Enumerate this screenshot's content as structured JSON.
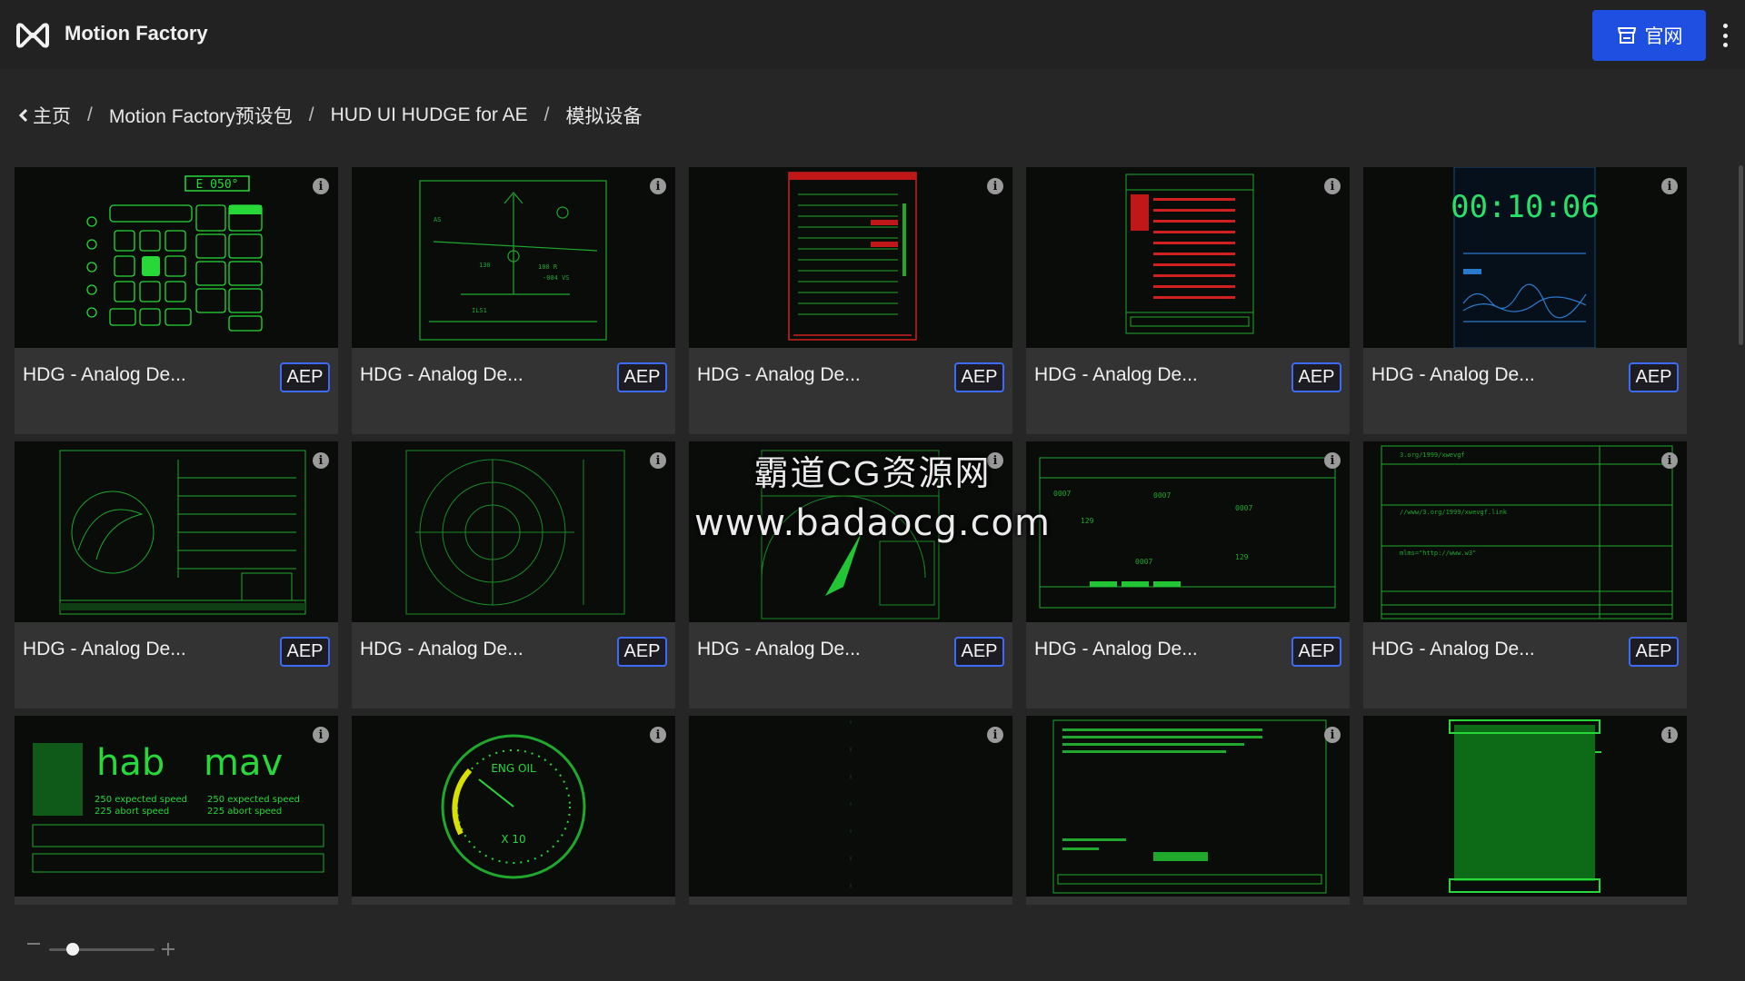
{
  "header": {
    "brand": "Motion Factory",
    "site_button_label": "官网"
  },
  "breadcrumb": {
    "items": [
      "主页",
      "Motion Factory预设包",
      "HUD UI HUDGE for AE",
      "模拟设备"
    ],
    "separator": "/"
  },
  "cards": [
    {
      "title": "HDG - Analog De...",
      "badge": "AEP",
      "thumb_text": "E 050°"
    },
    {
      "title": "HDG - Analog De...",
      "badge": "AEP",
      "thumb_text": ""
    },
    {
      "title": "HDG - Analog De...",
      "badge": "AEP",
      "thumb_text": ""
    },
    {
      "title": "HDG - Analog De...",
      "badge": "AEP",
      "thumb_text": ""
    },
    {
      "title": "HDG - Analog De...",
      "badge": "AEP",
      "thumb_text": "00:10:06"
    },
    {
      "title": "HDG - Analog De...",
      "badge": "AEP",
      "thumb_text": ""
    },
    {
      "title": "HDG - Analog De...",
      "badge": "AEP",
      "thumb_text": ""
    },
    {
      "title": "HDG - Analog De...",
      "badge": "AEP",
      "thumb_text": ""
    },
    {
      "title": "HDG - Analog De...",
      "badge": "AEP",
      "thumb_text": ""
    },
    {
      "title": "HDG - Analog De...",
      "badge": "AEP",
      "thumb_text": ""
    },
    {
      "title": "",
      "badge": "",
      "thumb_text": "hab"
    },
    {
      "title": "",
      "badge": "",
      "thumb_text": "ENG OIL"
    },
    {
      "title": "",
      "badge": "",
      "thumb_text": ""
    },
    {
      "title": "",
      "badge": "",
      "thumb_text": ""
    },
    {
      "title": "",
      "badge": "",
      "thumb_text": ""
    }
  ],
  "thumb_sub_text": {
    "card11_right": "mav",
    "card11_line1": "250 expected speed",
    "card11_line2": "225 abort speed",
    "card12_unit": "X 10"
  },
  "watermark": {
    "line1": "霸道CG资源网",
    "line2": "www.badaocg.com"
  },
  "icons": {
    "logo": "motion-factory-logo-icon",
    "site": "store-icon",
    "menu": "more-vertical-icon",
    "back": "chevron-left-icon",
    "info": "info-icon"
  },
  "colors": {
    "accent": "#1f4fe0",
    "badge_border": "#3d6bf5",
    "hud_green": "#27d838",
    "hud_red": "#e01e1e"
  },
  "zoom": {
    "level": 0.2
  }
}
